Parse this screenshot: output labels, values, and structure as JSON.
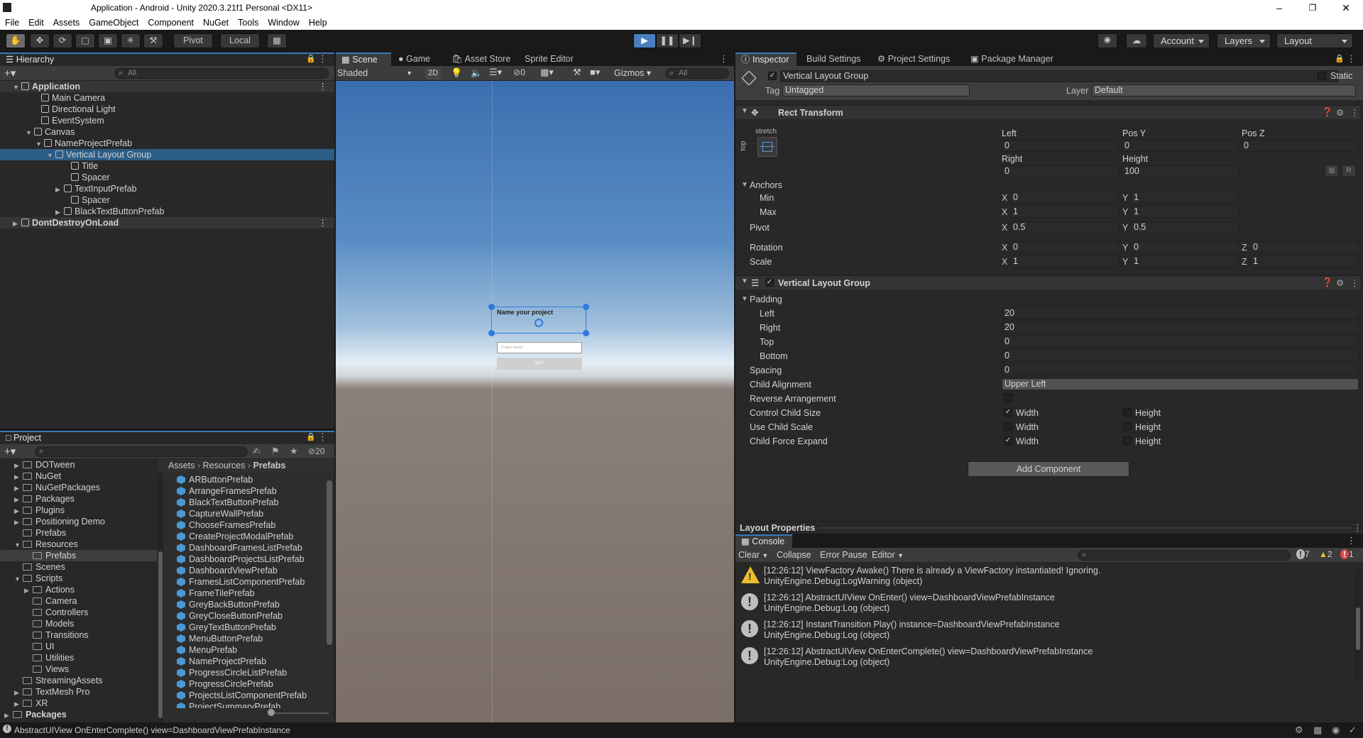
{
  "window": {
    "title": "Application - Android - Unity 2020.3.21f1 Personal <DX11>",
    "minimize": "–",
    "maximize": "❐",
    "close": "✕"
  },
  "menu": [
    "File",
    "Edit",
    "Assets",
    "GameObject",
    "Component",
    "NuGet",
    "Tools",
    "Window",
    "Help"
  ],
  "toolbar": {
    "pivot": "Pivot",
    "local": "Local",
    "account": "Account",
    "layers": "Layers",
    "layout": "Layout"
  },
  "hierarchy": {
    "tab": "Hierarchy",
    "search_placeholder": "All",
    "rows": [
      {
        "label": "Application",
        "type": "scene"
      },
      {
        "label": "Main Camera"
      },
      {
        "label": "Directional Light"
      },
      {
        "label": "EventSystem"
      },
      {
        "label": "Canvas"
      },
      {
        "label": "NameProjectPrefab"
      },
      {
        "label": "Vertical Layout Group",
        "selected": true
      },
      {
        "label": "Title"
      },
      {
        "label": "Spacer"
      },
      {
        "label": "TextInputPrefab"
      },
      {
        "label": "Spacer"
      },
      {
        "label": "BlackTextButtonPrefab"
      },
      {
        "label": "DontDestroyOnLoad",
        "type": "scene"
      }
    ]
  },
  "project": {
    "tab": "Project",
    "hidden_count": "20",
    "tree": [
      "DOTween",
      "NuGet",
      "NuGetPackages",
      "Packages",
      "Plugins",
      "Positioning Demo",
      "Prefabs",
      "Resources",
      "Prefabs",
      "Scenes",
      "Scripts",
      "Actions",
      "Camera",
      "Controllers",
      "Models",
      "Transitions",
      "UI",
      "Utilities",
      "Views",
      "StreamingAssets",
      "TextMesh Pro",
      "XR",
      "Packages"
    ],
    "breadcrumb": [
      "Assets",
      "Resources",
      "Prefabs"
    ],
    "files": [
      "ARButtonPrefab",
      "ArrangeFramesPrefab",
      "BlackTextButtonPrefab",
      "CaptureWallPrefab",
      "ChooseFramesPrefab",
      "CreateProjectModalPrefab",
      "DashboardFramesListPrefab",
      "DashboardProjectsListPrefab",
      "DashboardViewPrefab",
      "FramesListComponentPrefab",
      "FrameTilePrefab",
      "GreyBackButtonPrefab",
      "GreyCloseButtonPrefab",
      "GreyTextButtonPrefab",
      "MenuButtonPrefab",
      "MenuPrefab",
      "NameProjectPrefab",
      "ProgressCircleListPrefab",
      "ProgressCirclePrefab",
      "ProjectsListComponentPrefab",
      "ProjectSummaryPrefab"
    ]
  },
  "scene": {
    "tabs": [
      "Scene",
      "Game",
      "Asset Store",
      "Sprite Editor"
    ],
    "shading": "Shaded",
    "mode2d": "2D",
    "fx_count": "0",
    "gizmos": "Gizmos",
    "search_placeholder": "All",
    "ui_title": "Name your project",
    "ui_input_placeholder": "Project Name",
    "ui_button": "NEXT",
    "colors": {
      "sky_top": "#3a6eb0",
      "sky_horizon": "#e8f0f5",
      "ground": "#7a6e66"
    }
  },
  "inspector": {
    "tabs": [
      "Inspector",
      "Build Settings",
      "Project Settings",
      "Package Manager"
    ],
    "object_name": "Vertical Layout Group",
    "static_label": "Static",
    "tag_label": "Tag",
    "tag_value": "Untagged",
    "layer_label": "Layer",
    "layer_value": "Default",
    "rect_transform": {
      "title": "Rect Transform",
      "anchor_h": "stretch",
      "anchor_v": "top",
      "left_label": "Left",
      "left": "0",
      "posy_label": "Pos Y",
      "posy": "0",
      "posz_label": "Pos Z",
      "posz": "0",
      "right_label": "Right",
      "right": "0",
      "height_label": "Height",
      "height": "100",
      "anchors_label": "Anchors",
      "min_label": "Min",
      "min_x": "0",
      "min_y": "1",
      "max_label": "Max",
      "max_x": "1",
      "max_y": "1",
      "pivot_label": "Pivot",
      "pivot_x": "0.5",
      "pivot_y": "0.5",
      "rotation_label": "Rotation",
      "rot_x": "0",
      "rot_y": "0",
      "rot_z": "0",
      "scale_label": "Scale",
      "scale_x": "1",
      "scale_y": "1",
      "scale_z": "1",
      "r_button": "R"
    },
    "vlg": {
      "title": "Vertical Layout Group",
      "padding_label": "Padding",
      "left_label": "Left",
      "left": "20",
      "right_label": "Right",
      "right": "20",
      "top_label": "Top",
      "top": "0",
      "bottom_label": "Bottom",
      "bottom": "0",
      "spacing_label": "Spacing",
      "spacing": "0",
      "child_alignment_label": "Child Alignment",
      "child_alignment": "Upper Left",
      "reverse_label": "Reverse Arrangement",
      "control_label": "Control Child Size",
      "use_scale_label": "Use Child Scale",
      "expand_label": "Child Force Expand",
      "width": "Width",
      "height": "Height"
    },
    "add_component": "Add Component",
    "layout_properties": "Layout Properties"
  },
  "console": {
    "tab": "Console",
    "clear": "Clear",
    "collapse": "Collapse",
    "error_pause": "Error Pause",
    "editor": "Editor",
    "log_count": "7",
    "warn_count": "2",
    "error_count": "1",
    "entries": [
      {
        "type": "warning",
        "line1": "[12:26:12] ViewFactory Awake() There is already a ViewFactory instantiated! Ignoring.",
        "line2": "UnityEngine.Debug:LogWarning (object)"
      },
      {
        "type": "log",
        "line1": "[12:26:12] AbstractUIView OnEnter() view=DashboardViewPrefabInstance",
        "line2": "UnityEngine.Debug:Log (object)"
      },
      {
        "type": "log",
        "line1": "[12:26:12] InstantTransition Play() instance=DashboardViewPrefabInstance",
        "line2": "UnityEngine.Debug:Log (object)"
      },
      {
        "type": "log",
        "line1": "[12:26:12] AbstractUIView OnEnterComplete() view=DashboardViewPrefabInstance",
        "line2": "UnityEngine.Debug:Log (object)"
      }
    ]
  },
  "statusbar": {
    "message": "AbstractUIView OnEnterComplete() view=DashboardViewPrefabInstance"
  }
}
